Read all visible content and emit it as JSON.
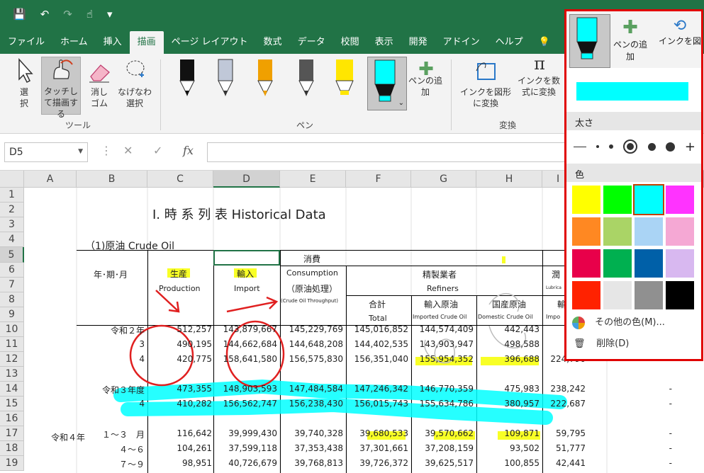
{
  "qat": {
    "save": "💾",
    "undo": "↶",
    "redo": "↷",
    "touch": "☝",
    "more": "▾"
  },
  "tabs": [
    "ファイル",
    "ホーム",
    "挿入",
    "描画",
    "ページ レイアウト",
    "数式",
    "データ",
    "校閲",
    "表示",
    "開発",
    "アドイン",
    "ヘルプ"
  ],
  "ribbon": {
    "select": "選択",
    "touch_draw": "タッチして描画する",
    "eraser": "消しゴム",
    "lasso": "なげなわ選択",
    "tools_group": "ツール",
    "add_pen": "ペンの追加",
    "pen_group": "ペン",
    "ink_to_shape": "インクを図形に変換",
    "ink_to_math": "インクを数式に変換",
    "convert_group": "変換",
    "ink_replay": "インクを図"
  },
  "formula_bar": {
    "cell_ref": "D5",
    "cancel": "✕",
    "enter": "✓",
    "fx": "fx",
    "value": ""
  },
  "columns": [
    "A",
    "B",
    "C",
    "D",
    "E",
    "F",
    "G",
    "H",
    "I"
  ],
  "rows": [
    "1",
    "2",
    "3",
    "4",
    "5",
    "6",
    "7",
    "8",
    "9",
    "10",
    "11",
    "12",
    "13",
    "14",
    "15",
    "16",
    "17",
    "18",
    "19"
  ],
  "sheet": {
    "title": "Ⅰ. 時 系 列 表  Historical Data",
    "subtitle": "（1)原油  Crude Oil",
    "hdr_consumption": "消費",
    "hdr_year": "年･期･月",
    "hdr_production_jp": "生産",
    "hdr_production_en": "Production",
    "hdr_import_jp": "輸入",
    "hdr_import_en": "Import",
    "hdr_consumption_en": "Consumption",
    "hdr_crude_processing": "（原油処理）",
    "hdr_crude_throughput": "(Crude Oil Throughput)",
    "hdr_refiners_jp": "精製業者",
    "hdr_refiners_en": "Refiners",
    "hdr_total_jp": "合計",
    "hdr_total_en": "Total",
    "hdr_imported_jp": "輸入原油",
    "hdr_imported_en": "Imported Crude Oil",
    "hdr_domestic_jp": "国産原油",
    "hdr_domestic_en": "Domestic Crude Oil",
    "hdr_lub_jp": "潤",
    "hdr_lub_en": "Lubrica",
    "hdr_lub2_jp": "輸",
    "hdr_lub2_en": "Impo",
    "rows": [
      {
        "label": "令和２年",
        "c": "512,257",
        "d": "143,879,667",
        "e": "145,229,769",
        "f": "145,016,852",
        "g": "144,574,409",
        "h": "442,443",
        "i": "",
        "j": ""
      },
      {
        "label": "3",
        "c": "490,195",
        "d": "144,662,684",
        "e": "144,648,208",
        "f": "144,402,535",
        "g": "143,903,947",
        "h": "498,588",
        "i": "",
        "j": ""
      },
      {
        "label": "4",
        "c": "420,775",
        "d": "158,641,580",
        "e": "156,575,830",
        "f": "156,351,040",
        "g": "155,954,352",
        "h": "396,688",
        "i": "224,790",
        "j": ""
      },
      {
        "label": "",
        "c": "",
        "d": "",
        "e": "",
        "f": "",
        "g": "",
        "h": "",
        "i": "",
        "j": ""
      },
      {
        "label": "令和３年度",
        "c": "473,355",
        "d": "148,903,593",
        "e": "147,484,584",
        "f": "147,246,342",
        "g": "146,770,359",
        "h": "475,983",
        "i": "238,242",
        "j": "-"
      },
      {
        "label": "4",
        "c": "410,282",
        "d": "156,562,747",
        "e": "156,238,430",
        "f": "156,015,743",
        "g": "155,634,786",
        "h": "380,957",
        "i": "222,687",
        "j": "-"
      },
      {
        "label": "",
        "c": "",
        "d": "",
        "e": "",
        "f": "",
        "g": "",
        "h": "",
        "i": "",
        "j": ""
      },
      {
        "label": "１～３　月",
        "c": "116,642",
        "d": "39,999,430",
        "e": "39,740,328",
        "f": "39,680,533",
        "g": "39,570,662",
        "h": "109,871",
        "i": "59,795",
        "j": "-"
      },
      {
        "label": "４～６",
        "c": "104,261",
        "d": "37,599,118",
        "e": "37,353,438",
        "f": "37,301,661",
        "g": "37,208,159",
        "h": "93,502",
        "i": "51,777",
        "j": "-"
      },
      {
        "label": "７～９",
        "c": "98,951",
        "d": "40,726,679",
        "e": "39,768,813",
        "f": "39,726,372",
        "g": "39,625,517",
        "h": "100,855",
        "i": "42,441",
        "j": "-"
      }
    ],
    "row17_prefix": "令和４年"
  },
  "pen_popup": {
    "thickness_label": "太さ",
    "color_label": "色",
    "add_pen": "ペンの追加",
    "ink_to": "インクを図",
    "selected_color": "#00ffff",
    "colors": [
      "#ffff00",
      "#00ff00",
      "#00ffff",
      "#ff33ff",
      "#ff8822",
      "#aad466",
      "#aad4f5",
      "#f5a8d4",
      "#e8004a",
      "#00b050",
      "#0060a8",
      "#d8b8f0",
      "#ff2200",
      "#e6e6e6",
      "#909090",
      "#000000"
    ],
    "more_colors": "その他の色(M)...",
    "delete": "削除(D)"
  }
}
